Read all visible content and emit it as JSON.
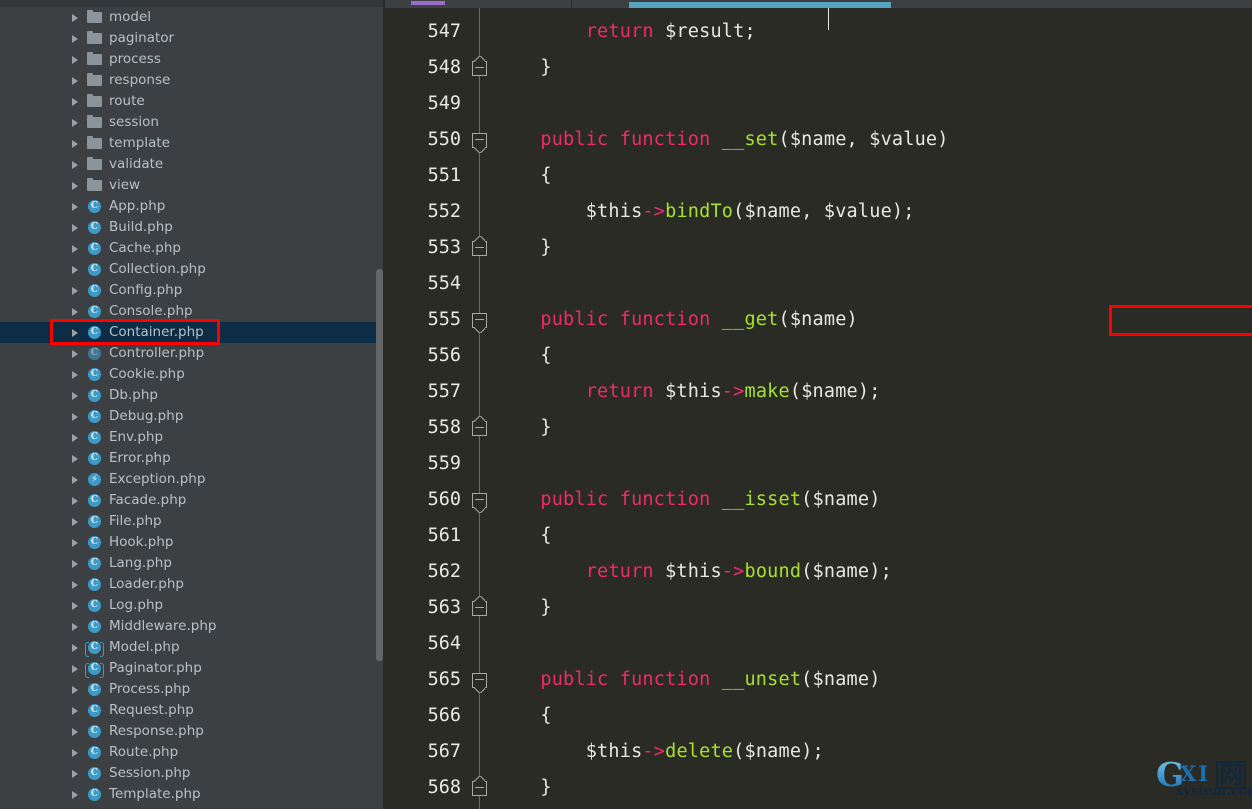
{
  "sidebar": {
    "name": "project-file-tree",
    "scrollbar": "vertical-scrollbar",
    "items": [
      {
        "label": "model",
        "icon": "folder-icon",
        "kind": "folder",
        "selected": false
      },
      {
        "label": "paginator",
        "icon": "folder-icon",
        "kind": "folder",
        "selected": false
      },
      {
        "label": "process",
        "icon": "folder-icon",
        "kind": "folder",
        "selected": false
      },
      {
        "label": "response",
        "icon": "folder-icon",
        "kind": "folder",
        "selected": false
      },
      {
        "label": "route",
        "icon": "folder-icon",
        "kind": "folder",
        "selected": false
      },
      {
        "label": "session",
        "icon": "folder-icon",
        "kind": "folder",
        "selected": false
      },
      {
        "label": "template",
        "icon": "folder-icon",
        "kind": "folder",
        "selected": false
      },
      {
        "label": "validate",
        "icon": "folder-icon",
        "kind": "folder",
        "selected": false
      },
      {
        "label": "view",
        "icon": "folder-icon",
        "kind": "folder",
        "selected": false
      },
      {
        "label": "App.php",
        "icon": "php-class-icon",
        "kind": "class",
        "selected": false
      },
      {
        "label": "Build.php",
        "icon": "php-class-icon",
        "kind": "class",
        "selected": false
      },
      {
        "label": "Cache.php",
        "icon": "php-class-icon",
        "kind": "class",
        "selected": false
      },
      {
        "label": "Collection.php",
        "icon": "php-class-icon",
        "kind": "class",
        "selected": false
      },
      {
        "label": "Config.php",
        "icon": "php-class-icon",
        "kind": "class",
        "selected": false
      },
      {
        "label": "Console.php",
        "icon": "php-class-icon",
        "kind": "class",
        "selected": false
      },
      {
        "label": "Container.php",
        "icon": "php-class-icon",
        "kind": "class",
        "selected": true
      },
      {
        "label": "Controller.php",
        "icon": "php-class-icon",
        "kind": "class-dim",
        "selected": false
      },
      {
        "label": "Cookie.php",
        "icon": "php-class-icon",
        "kind": "class",
        "selected": false
      },
      {
        "label": "Db.php",
        "icon": "php-class-icon",
        "kind": "class",
        "selected": false
      },
      {
        "label": "Debug.php",
        "icon": "php-class-icon",
        "kind": "class",
        "selected": false
      },
      {
        "label": "Env.php",
        "icon": "php-class-icon",
        "kind": "class",
        "selected": false
      },
      {
        "label": "Error.php",
        "icon": "php-class-icon",
        "kind": "class",
        "selected": false
      },
      {
        "label": "Exception.php",
        "icon": "php-exception-icon",
        "kind": "exception",
        "selected": false
      },
      {
        "label": "Facade.php",
        "icon": "php-class-icon",
        "kind": "class",
        "selected": false
      },
      {
        "label": "File.php",
        "icon": "php-class-icon",
        "kind": "class",
        "selected": false
      },
      {
        "label": "Hook.php",
        "icon": "php-class-icon",
        "kind": "class",
        "selected": false
      },
      {
        "label": "Lang.php",
        "icon": "php-class-icon",
        "kind": "class",
        "selected": false
      },
      {
        "label": "Loader.php",
        "icon": "php-class-icon",
        "kind": "class",
        "selected": false
      },
      {
        "label": "Log.php",
        "icon": "php-class-icon",
        "kind": "class",
        "selected": false
      },
      {
        "label": "Middleware.php",
        "icon": "php-class-icon",
        "kind": "class",
        "selected": false
      },
      {
        "label": "Model.php",
        "icon": "php-abstract-class-icon",
        "kind": "abstract",
        "selected": false
      },
      {
        "label": "Paginator.php",
        "icon": "php-abstract-class-icon",
        "kind": "abstract",
        "selected": false
      },
      {
        "label": "Process.php",
        "icon": "php-class-icon",
        "kind": "class",
        "selected": false
      },
      {
        "label": "Request.php",
        "icon": "php-class-icon",
        "kind": "class",
        "selected": false
      },
      {
        "label": "Response.php",
        "icon": "php-class-icon",
        "kind": "class",
        "selected": false
      },
      {
        "label": "Route.php",
        "icon": "php-class-icon",
        "kind": "class",
        "selected": false
      },
      {
        "label": "Session.php",
        "icon": "php-class-icon",
        "kind": "class",
        "selected": false
      },
      {
        "label": "Template.php",
        "icon": "php-class-icon",
        "kind": "class",
        "selected": false
      }
    ]
  },
  "editor": {
    "name": "code-editor",
    "first_visible_line": 547,
    "lines": [
      {
        "no": 547,
        "fold": null,
        "tokens": [
          {
            "t": "        ",
            "c": "punc"
          },
          {
            "t": "return",
            "c": "kw"
          },
          {
            "t": " ",
            "c": "punc"
          },
          {
            "t": "$result",
            "c": "var"
          },
          {
            "t": ";",
            "c": "punc"
          }
        ]
      },
      {
        "no": 548,
        "fold": "up",
        "tokens": [
          {
            "t": "    }",
            "c": "punc"
          }
        ]
      },
      {
        "no": 549,
        "fold": null,
        "tokens": []
      },
      {
        "no": 550,
        "fold": "down",
        "tokens": [
          {
            "t": "    ",
            "c": "punc"
          },
          {
            "t": "public",
            "c": "kw"
          },
          {
            "t": " ",
            "c": "punc"
          },
          {
            "t": "function",
            "c": "kw"
          },
          {
            "t": " ",
            "c": "punc"
          },
          {
            "t": "__set",
            "c": "fn"
          },
          {
            "t": "(",
            "c": "punc"
          },
          {
            "t": "$name",
            "c": "var"
          },
          {
            "t": ", ",
            "c": "punc"
          },
          {
            "t": "$value",
            "c": "var"
          },
          {
            "t": ")",
            "c": "punc"
          }
        ]
      },
      {
        "no": 551,
        "fold": null,
        "tokens": [
          {
            "t": "    {",
            "c": "punc"
          }
        ]
      },
      {
        "no": 552,
        "fold": null,
        "tokens": [
          {
            "t": "        ",
            "c": "punc"
          },
          {
            "t": "$this",
            "c": "var"
          },
          {
            "t": "->",
            "c": "op"
          },
          {
            "t": "bindTo",
            "c": "fn"
          },
          {
            "t": "(",
            "c": "punc"
          },
          {
            "t": "$name",
            "c": "var"
          },
          {
            "t": ", ",
            "c": "punc"
          },
          {
            "t": "$value",
            "c": "var"
          },
          {
            "t": ");",
            "c": "punc"
          }
        ]
      },
      {
        "no": 553,
        "fold": "up",
        "tokens": [
          {
            "t": "    }",
            "c": "punc"
          }
        ]
      },
      {
        "no": 554,
        "fold": null,
        "tokens": []
      },
      {
        "no": 555,
        "fold": "down",
        "tokens": [
          {
            "t": "    ",
            "c": "punc"
          },
          {
            "t": "public",
            "c": "kw"
          },
          {
            "t": " ",
            "c": "punc"
          },
          {
            "t": "function",
            "c": "kw"
          },
          {
            "t": " ",
            "c": "punc"
          },
          {
            "t": "__get",
            "c": "fn"
          },
          {
            "t": "(",
            "c": "punc"
          },
          {
            "t": "$name",
            "c": "var"
          },
          {
            "t": ")",
            "c": "punc"
          }
        ]
      },
      {
        "no": 556,
        "fold": null,
        "tokens": [
          {
            "t": "    {",
            "c": "punc"
          }
        ]
      },
      {
        "no": 557,
        "fold": null,
        "tokens": [
          {
            "t": "        ",
            "c": "punc"
          },
          {
            "t": "return",
            "c": "kw"
          },
          {
            "t": " ",
            "c": "punc"
          },
          {
            "t": "$this",
            "c": "var"
          },
          {
            "t": "->",
            "c": "op"
          },
          {
            "t": "make",
            "c": "fn"
          },
          {
            "t": "(",
            "c": "punc"
          },
          {
            "t": "$name",
            "c": "var"
          },
          {
            "t": ");",
            "c": "punc"
          }
        ]
      },
      {
        "no": 558,
        "fold": "up",
        "tokens": [
          {
            "t": "    }",
            "c": "punc"
          }
        ]
      },
      {
        "no": 559,
        "fold": null,
        "tokens": []
      },
      {
        "no": 560,
        "fold": "down",
        "tokens": [
          {
            "t": "    ",
            "c": "punc"
          },
          {
            "t": "public",
            "c": "kw"
          },
          {
            "t": " ",
            "c": "punc"
          },
          {
            "t": "function",
            "c": "kw"
          },
          {
            "t": " ",
            "c": "punc"
          },
          {
            "t": "__isset",
            "c": "fn"
          },
          {
            "t": "(",
            "c": "punc"
          },
          {
            "t": "$name",
            "c": "var"
          },
          {
            "t": ")",
            "c": "punc"
          }
        ]
      },
      {
        "no": 561,
        "fold": null,
        "tokens": [
          {
            "t": "    {",
            "c": "punc"
          }
        ]
      },
      {
        "no": 562,
        "fold": null,
        "tokens": [
          {
            "t": "        ",
            "c": "punc"
          },
          {
            "t": "return",
            "c": "kw"
          },
          {
            "t": " ",
            "c": "punc"
          },
          {
            "t": "$this",
            "c": "var"
          },
          {
            "t": "->",
            "c": "op"
          },
          {
            "t": "bound",
            "c": "fn"
          },
          {
            "t": "(",
            "c": "punc"
          },
          {
            "t": "$name",
            "c": "var"
          },
          {
            "t": ");",
            "c": "punc"
          }
        ]
      },
      {
        "no": 563,
        "fold": "up",
        "tokens": [
          {
            "t": "    }",
            "c": "punc"
          }
        ]
      },
      {
        "no": 564,
        "fold": null,
        "tokens": []
      },
      {
        "no": 565,
        "fold": "down",
        "tokens": [
          {
            "t": "    ",
            "c": "punc"
          },
          {
            "t": "public",
            "c": "kw"
          },
          {
            "t": " ",
            "c": "punc"
          },
          {
            "t": "function",
            "c": "kw"
          },
          {
            "t": " ",
            "c": "punc"
          },
          {
            "t": "__unset",
            "c": "fn"
          },
          {
            "t": "(",
            "c": "punc"
          },
          {
            "t": "$name",
            "c": "var"
          },
          {
            "t": ")",
            "c": "punc"
          }
        ]
      },
      {
        "no": 566,
        "fold": null,
        "tokens": [
          {
            "t": "    {",
            "c": "punc"
          }
        ]
      },
      {
        "no": 567,
        "fold": null,
        "tokens": [
          {
            "t": "        ",
            "c": "punc"
          },
          {
            "t": "$this",
            "c": "var"
          },
          {
            "t": "->",
            "c": "op"
          },
          {
            "t": "delete",
            "c": "fn"
          },
          {
            "t": "(",
            "c": "punc"
          },
          {
            "t": "$name",
            "c": "var"
          },
          {
            "t": ");",
            "c": "punc"
          }
        ]
      },
      {
        "no": 568,
        "fold": "up",
        "tokens": [
          {
            "t": "    }",
            "c": "punc"
          }
        ]
      }
    ]
  },
  "annotations": [
    {
      "name": "annotation-box-container-php",
      "color": "#fe0000",
      "target": "Container.php"
    },
    {
      "name": "annotation-box-get-method",
      "color": "#fe0000",
      "target": "__get($name)"
    }
  ],
  "watermark": {
    "g": "G",
    "xi": "XI",
    "cn": "网",
    "sub": "system.com"
  },
  "colors": {
    "sidebar_bg": "#3c4043",
    "editor_bg": "#2b2b26",
    "selection_bg": "#0d2c45",
    "keyword": "#ef2a6b",
    "function": "#a6e22e",
    "text": "#e8e8e2",
    "tab_active": "#56a4bd",
    "annotation": "#fe0000"
  }
}
